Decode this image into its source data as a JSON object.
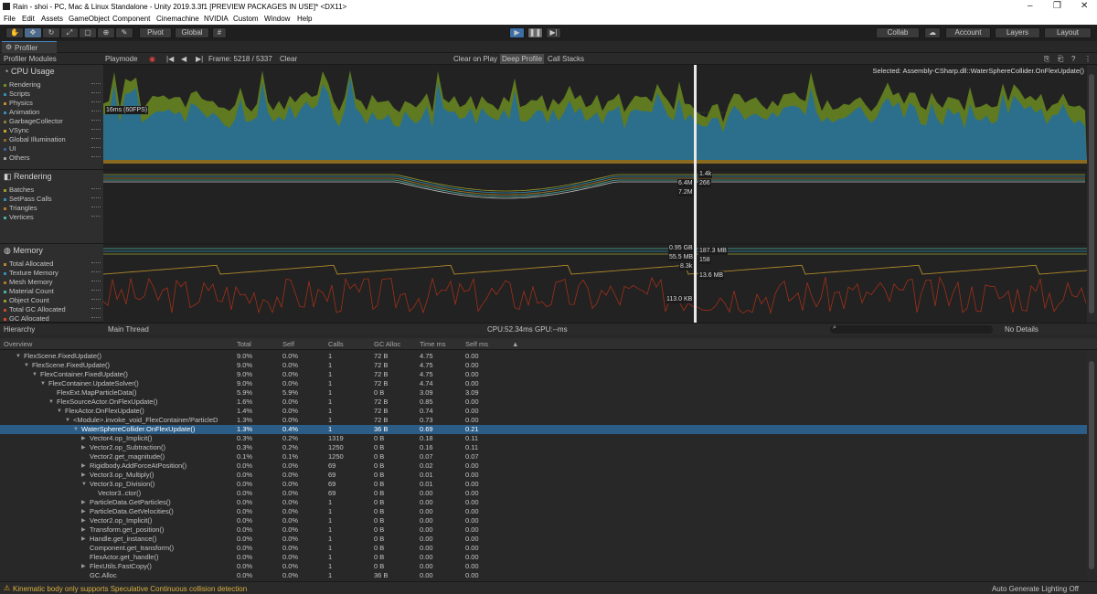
{
  "window": {
    "title": "Rain - shoi - PC, Mac & Linux Standalone - Unity 2019.3.3f1 [PREVIEW PACKAGES IN USE]* <DX11>"
  },
  "menu": [
    "File",
    "Edit",
    "Assets",
    "GameObject",
    "Component",
    "Cinemachine",
    "NVIDIA",
    "Custom",
    "Window",
    "Help"
  ],
  "toolbar": {
    "pivot": "Pivot",
    "global": "Global",
    "collab": "Collab",
    "account": "Account",
    "layers": "Layers",
    "layout": "Layout"
  },
  "tab": {
    "label": "Profiler"
  },
  "controls": {
    "modules": "Profiler Modules",
    "playmode": "Playmode",
    "frame": "Frame: 5218 / 5337",
    "clear": "Clear",
    "clear_on_play": "Clear on Play",
    "deep_profile": "Deep Profile",
    "call_stacks": "Call Stacks"
  },
  "cpu": {
    "title": "CPU Usage",
    "selected": "Selected: Assembly-CSharp.dll::WaterSphereCollider.OnFlexUpdate()",
    "fps_label": "16ms (60FPS)",
    "legend": [
      {
        "name": "Rendering",
        "color": "#6b8f1f"
      },
      {
        "name": "Scripts",
        "color": "#2f8fb5"
      },
      {
        "name": "Physics",
        "color": "#c08a25"
      },
      {
        "name": "Animation",
        "color": "#2f8fb5"
      },
      {
        "name": "GarbageCollector",
        "color": "#8e7a3a"
      },
      {
        "name": "VSync",
        "color": "#c7a52a"
      },
      {
        "name": "Global Illumination",
        "color": "#8f6a1e"
      },
      {
        "name": "UI",
        "color": "#3a5f99"
      },
      {
        "name": "Others",
        "color": "#a2a2a2"
      }
    ]
  },
  "rendering": {
    "title": "Rendering",
    "legend": [
      {
        "name": "Batches",
        "color": "#9b9b2a"
      },
      {
        "name": "SetPass Calls",
        "color": "#2f8fb5"
      },
      {
        "name": "Triangles",
        "color": "#b07a25"
      },
      {
        "name": "Vertices",
        "color": "#4bb0a0"
      }
    ],
    "labels": {
      "a": "1.4k",
      "b": "6.4M",
      "c": "266",
      "d": "7.2M"
    }
  },
  "memory": {
    "title": "Memory",
    "legend": [
      {
        "name": "Total Allocated",
        "color": "#b08a2a"
      },
      {
        "name": "Texture Memory",
        "color": "#2f8fb5"
      },
      {
        "name": "Mesh Memory",
        "color": "#b07a25"
      },
      {
        "name": "Material Count",
        "color": "#4bb0a0"
      },
      {
        "name": "Object Count",
        "color": "#9b9b2a"
      },
      {
        "name": "Total GC Allocated",
        "color": "#c05020"
      },
      {
        "name": "GC Allocated",
        "color": "#d34a2a"
      }
    ],
    "labels": {
      "a": "0.95 GB",
      "b": "187.3 MB",
      "c": "55.5 MB",
      "d": "158",
      "e": "8.3k",
      "f": "13.6 MB",
      "g": "113.0 KB"
    }
  },
  "hierarchy": {
    "view": "Hierarchy",
    "thread": "Main Thread",
    "cpu": "CPU:52.34ms  GPU:--ms",
    "details": "No Details"
  },
  "columns": [
    "Overview",
    "Total",
    "Self",
    "Calls",
    "GC Alloc",
    "Time ms",
    "Self ms"
  ],
  "rows": [
    {
      "name": "FlexScene.FixedUpdate()",
      "indent": 2,
      "exp": "▼",
      "total": "9.0%",
      "self": "0.0%",
      "calls": "1",
      "gc": "72 B",
      "time": "4.75",
      "selfms": "0.00"
    },
    {
      "name": "FlexScene.FixedUpdate()",
      "indent": 3,
      "exp": "▼",
      "total": "9.0%",
      "self": "0.0%",
      "calls": "1",
      "gc": "72 B",
      "time": "4.75",
      "selfms": "0.00"
    },
    {
      "name": "FlexContainer.FixedUpdate()",
      "indent": 4,
      "exp": "▼",
      "total": "9.0%",
      "self": "0.0%",
      "calls": "1",
      "gc": "72 B",
      "time": "4.75",
      "selfms": "0.00"
    },
    {
      "name": "FlexContainer.UpdateSolver()",
      "indent": 5,
      "exp": "▼",
      "total": "9.0%",
      "self": "0.0%",
      "calls": "1",
      "gc": "72 B",
      "time": "4.74",
      "selfms": "0.00"
    },
    {
      "name": "FlexExt.MapParticleData()",
      "indent": 6,
      "exp": "",
      "total": "5.9%",
      "self": "5.9%",
      "calls": "1",
      "gc": "0 B",
      "time": "3.09",
      "selfms": "3.09"
    },
    {
      "name": "FlexSourceActor.OnFlexUpdate()",
      "indent": 6,
      "exp": "▼",
      "total": "1.6%",
      "self": "0.0%",
      "calls": "1",
      "gc": "72 B",
      "time": "0.85",
      "selfms": "0.00"
    },
    {
      "name": "FlexActor.OnFlexUpdate()",
      "indent": 7,
      "exp": "▼",
      "total": "1.4%",
      "self": "0.0%",
      "calls": "1",
      "gc": "72 B",
      "time": "0.74",
      "selfms": "0.00"
    },
    {
      "name": "<Module>.invoke_void_FlexContainer/ParticleD",
      "indent": 8,
      "exp": "▼",
      "total": "1.3%",
      "self": "0.0%",
      "calls": "1",
      "gc": "72 B",
      "time": "0.73",
      "selfms": "0.00"
    },
    {
      "name": "WaterSphereCollider.OnFlexUpdate()",
      "indent": 9,
      "exp": "▼",
      "total": "1.3%",
      "self": "0.4%",
      "calls": "1",
      "gc": "36 B",
      "time": "0.69",
      "selfms": "0.21",
      "selected": true
    },
    {
      "name": "Vector4.op_Implicit()",
      "indent": 10,
      "exp": "▶",
      "total": "0.3%",
      "self": "0.2%",
      "calls": "1319",
      "gc": "0 B",
      "time": "0.18",
      "selfms": "0.11"
    },
    {
      "name": "Vector2.op_Subtraction()",
      "indent": 10,
      "exp": "▶",
      "total": "0.3%",
      "self": "0.2%",
      "calls": "1250",
      "gc": "0 B",
      "time": "0.16",
      "selfms": "0.11"
    },
    {
      "name": "Vector2.get_magnitude()",
      "indent": 10,
      "exp": "",
      "total": "0.1%",
      "self": "0.1%",
      "calls": "1250",
      "gc": "0 B",
      "time": "0.07",
      "selfms": "0.07"
    },
    {
      "name": "Rigidbody.AddForceAtPosition()",
      "indent": 10,
      "exp": "▶",
      "total": "0.0%",
      "self": "0.0%",
      "calls": "69",
      "gc": "0 B",
      "time": "0.02",
      "selfms": "0.00"
    },
    {
      "name": "Vector3.op_Multiply()",
      "indent": 10,
      "exp": "▶",
      "total": "0.0%",
      "self": "0.0%",
      "calls": "69",
      "gc": "0 B",
      "time": "0.01",
      "selfms": "0.00"
    },
    {
      "name": "Vector3.op_Division()",
      "indent": 10,
      "exp": "▼",
      "total": "0.0%",
      "self": "0.0%",
      "calls": "69",
      "gc": "0 B",
      "time": "0.01",
      "selfms": "0.00"
    },
    {
      "name": "Vector3..ctor()",
      "indent": 11,
      "exp": "",
      "total": "0.0%",
      "self": "0.0%",
      "calls": "69",
      "gc": "0 B",
      "time": "0.00",
      "selfms": "0.00"
    },
    {
      "name": "ParticleData.GetParticles()",
      "indent": 10,
      "exp": "▶",
      "total": "0.0%",
      "self": "0.0%",
      "calls": "1",
      "gc": "0 B",
      "time": "0.00",
      "selfms": "0.00"
    },
    {
      "name": "ParticleData.GetVelocities()",
      "indent": 10,
      "exp": "▶",
      "total": "0.0%",
      "self": "0.0%",
      "calls": "1",
      "gc": "0 B",
      "time": "0.00",
      "selfms": "0.00"
    },
    {
      "name": "Vector2.op_Implicit()",
      "indent": 10,
      "exp": "▶",
      "total": "0.0%",
      "self": "0.0%",
      "calls": "1",
      "gc": "0 B",
      "time": "0.00",
      "selfms": "0.00"
    },
    {
      "name": "Transform.get_position()",
      "indent": 10,
      "exp": "▶",
      "total": "0.0%",
      "self": "0.0%",
      "calls": "1",
      "gc": "0 B",
      "time": "0.00",
      "selfms": "0.00"
    },
    {
      "name": "Handle.get_instance()",
      "indent": 10,
      "exp": "▶",
      "total": "0.0%",
      "self": "0.0%",
      "calls": "1",
      "gc": "0 B",
      "time": "0.00",
      "selfms": "0.00"
    },
    {
      "name": "Component.get_transform()",
      "indent": 10,
      "exp": "",
      "total": "0.0%",
      "self": "0.0%",
      "calls": "1",
      "gc": "0 B",
      "time": "0.00",
      "selfms": "0.00"
    },
    {
      "name": "FlexActor.get_handle()",
      "indent": 10,
      "exp": "",
      "total": "0.0%",
      "self": "0.0%",
      "calls": "1",
      "gc": "0 B",
      "time": "0.00",
      "selfms": "0.00"
    },
    {
      "name": "FlexUtils.FastCopy()",
      "indent": 10,
      "exp": "▶",
      "total": "0.0%",
      "self": "0.0%",
      "calls": "1",
      "gc": "0 B",
      "time": "0.00",
      "selfms": "0.00"
    },
    {
      "name": "GC.Alloc",
      "indent": 10,
      "exp": "",
      "total": "0.0%",
      "self": "0.0%",
      "calls": "1",
      "gc": "36 B",
      "time": "0.00",
      "selfms": "0.00"
    }
  ],
  "status": {
    "message": "Kinematic body only supports Speculative Continuous collision detection",
    "right": "Auto Generate Lighting Off"
  }
}
